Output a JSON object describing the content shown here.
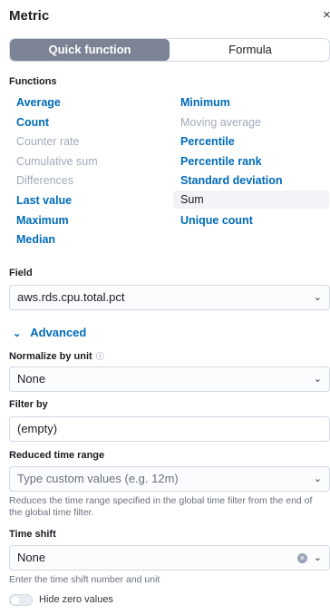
{
  "header": {
    "title": "Metric",
    "close_glyph": "×"
  },
  "mode_toggle": {
    "quick_label": "Quick function",
    "formula_label": "Formula",
    "selected": "Quick function"
  },
  "functions": {
    "label": "Functions",
    "left": [
      {
        "label": "Average",
        "state": "active"
      },
      {
        "label": "Count",
        "state": "active"
      },
      {
        "label": "Counter rate",
        "state": "disabled"
      },
      {
        "label": "Cumulative sum",
        "state": "disabled"
      },
      {
        "label": "Differences",
        "state": "disabled"
      },
      {
        "label": "Last value",
        "state": "active"
      },
      {
        "label": "Maximum",
        "state": "active"
      },
      {
        "label": "Median",
        "state": "active"
      }
    ],
    "right": [
      {
        "label": "Minimum",
        "state": "active"
      },
      {
        "label": "Moving average",
        "state": "disabled"
      },
      {
        "label": "Percentile",
        "state": "active"
      },
      {
        "label": "Percentile rank",
        "state": "active"
      },
      {
        "label": "Standard deviation",
        "state": "active"
      },
      {
        "label": "Sum",
        "state": "selected"
      },
      {
        "label": "Unique count",
        "state": "active"
      }
    ]
  },
  "field": {
    "label": "Field",
    "value": "aws.rds.cpu.total.pct"
  },
  "advanced": {
    "label": "Advanced"
  },
  "normalize": {
    "label": "Normalize by unit",
    "value": "None"
  },
  "filter_by": {
    "label": "Filter by",
    "value": "(empty)"
  },
  "reduced_time_range": {
    "label": "Reduced time range",
    "placeholder": "Type custom values (e.g. 12m)",
    "help": "Reduces the time range specified in the global time filter from the end of the global time filter."
  },
  "time_shift": {
    "label": "Time shift",
    "value": "None",
    "help": "Enter the time shift number and unit"
  },
  "hide_zero": {
    "label": "Hide zero values",
    "enabled": false
  },
  "colors": {
    "accent": "#006bb8",
    "toggle_selected": "#7b8394",
    "disabled_text": "#a2abba"
  }
}
